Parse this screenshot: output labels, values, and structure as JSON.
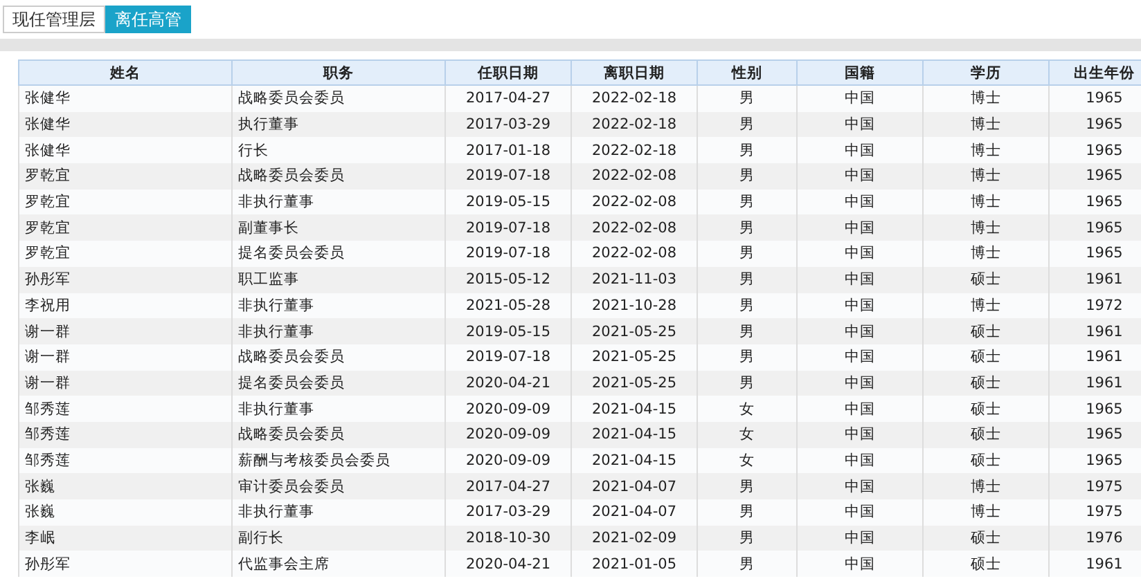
{
  "tabs": [
    {
      "label": "现任管理层",
      "selected": false
    },
    {
      "label": "离任高管",
      "selected": true
    }
  ],
  "table": {
    "columns": [
      "姓名",
      "职务",
      "任职日期",
      "离职日期",
      "性别",
      "国籍",
      "学历",
      "出生年份"
    ],
    "rows": [
      {
        "cells": [
          "张健华",
          "战略委员会委员",
          "2017-04-27",
          "2022-02-18",
          "男",
          "中国",
          "博士",
          "1965"
        ]
      },
      {
        "cells": [
          "张健华",
          "执行董事",
          "2017-03-29",
          "2022-02-18",
          "男",
          "中国",
          "博士",
          "1965"
        ]
      },
      {
        "cells": [
          "张健华",
          "行长",
          "2017-01-18",
          "2022-02-18",
          "男",
          "中国",
          "博士",
          "1965"
        ]
      },
      {
        "cells": [
          "罗乾宜",
          "战略委员会委员",
          "2019-07-18",
          "2022-02-08",
          "男",
          "中国",
          "博士",
          "1965"
        ]
      },
      {
        "cells": [
          "罗乾宜",
          "非执行董事",
          "2019-05-15",
          "2022-02-08",
          "男",
          "中国",
          "博士",
          "1965"
        ]
      },
      {
        "cells": [
          "罗乾宜",
          "副董事长",
          "2019-07-18",
          "2022-02-08",
          "男",
          "中国",
          "博士",
          "1965"
        ]
      },
      {
        "cells": [
          "罗乾宜",
          "提名委员会委员",
          "2019-07-18",
          "2022-02-08",
          "男",
          "中国",
          "博士",
          "1965"
        ]
      },
      {
        "cells": [
          "孙彤军",
          "职工监事",
          "2015-05-12",
          "2021-11-03",
          "男",
          "中国",
          "硕士",
          "1961"
        ]
      },
      {
        "cells": [
          "李祝用",
          "非执行董事",
          "2021-05-28",
          "2021-10-28",
          "男",
          "中国",
          "博士",
          "1972"
        ]
      },
      {
        "cells": [
          "谢一群",
          "非执行董事",
          "2019-05-15",
          "2021-05-25",
          "男",
          "中国",
          "硕士",
          "1961"
        ]
      },
      {
        "cells": [
          "谢一群",
          "战略委员会委员",
          "2019-07-18",
          "2021-05-25",
          "男",
          "中国",
          "硕士",
          "1961"
        ]
      },
      {
        "cells": [
          "谢一群",
          "提名委员会委员",
          "2020-04-21",
          "2021-05-25",
          "男",
          "中国",
          "硕士",
          "1961"
        ]
      },
      {
        "cells": [
          "邹秀莲",
          "非执行董事",
          "2020-09-09",
          "2021-04-15",
          "女",
          "中国",
          "硕士",
          "1965"
        ]
      },
      {
        "cells": [
          "邹秀莲",
          "战略委员会委员",
          "2020-09-09",
          "2021-04-15",
          "女",
          "中国",
          "硕士",
          "1965"
        ]
      },
      {
        "cells": [
          "邹秀莲",
          "薪酬与考核委员会委员",
          "2020-09-09",
          "2021-04-15",
          "女",
          "中国",
          "硕士",
          "1965"
        ]
      },
      {
        "cells": [
          "张巍",
          "审计委员会委员",
          "2017-04-27",
          "2021-04-07",
          "男",
          "中国",
          "博士",
          "1975"
        ]
      },
      {
        "cells": [
          "张巍",
          "非执行董事",
          "2017-03-29",
          "2021-04-07",
          "男",
          "中国",
          "博士",
          "1975"
        ]
      },
      {
        "cells": [
          "李岷",
          "副行长",
          "2018-10-30",
          "2021-02-09",
          "男",
          "中国",
          "硕士",
          "1976"
        ]
      },
      {
        "cells": [
          "孙彤军",
          "代监事会主席",
          "2020-04-21",
          "2021-01-05",
          "男",
          "中国",
          "硕士",
          "1961"
        ]
      }
    ]
  }
}
